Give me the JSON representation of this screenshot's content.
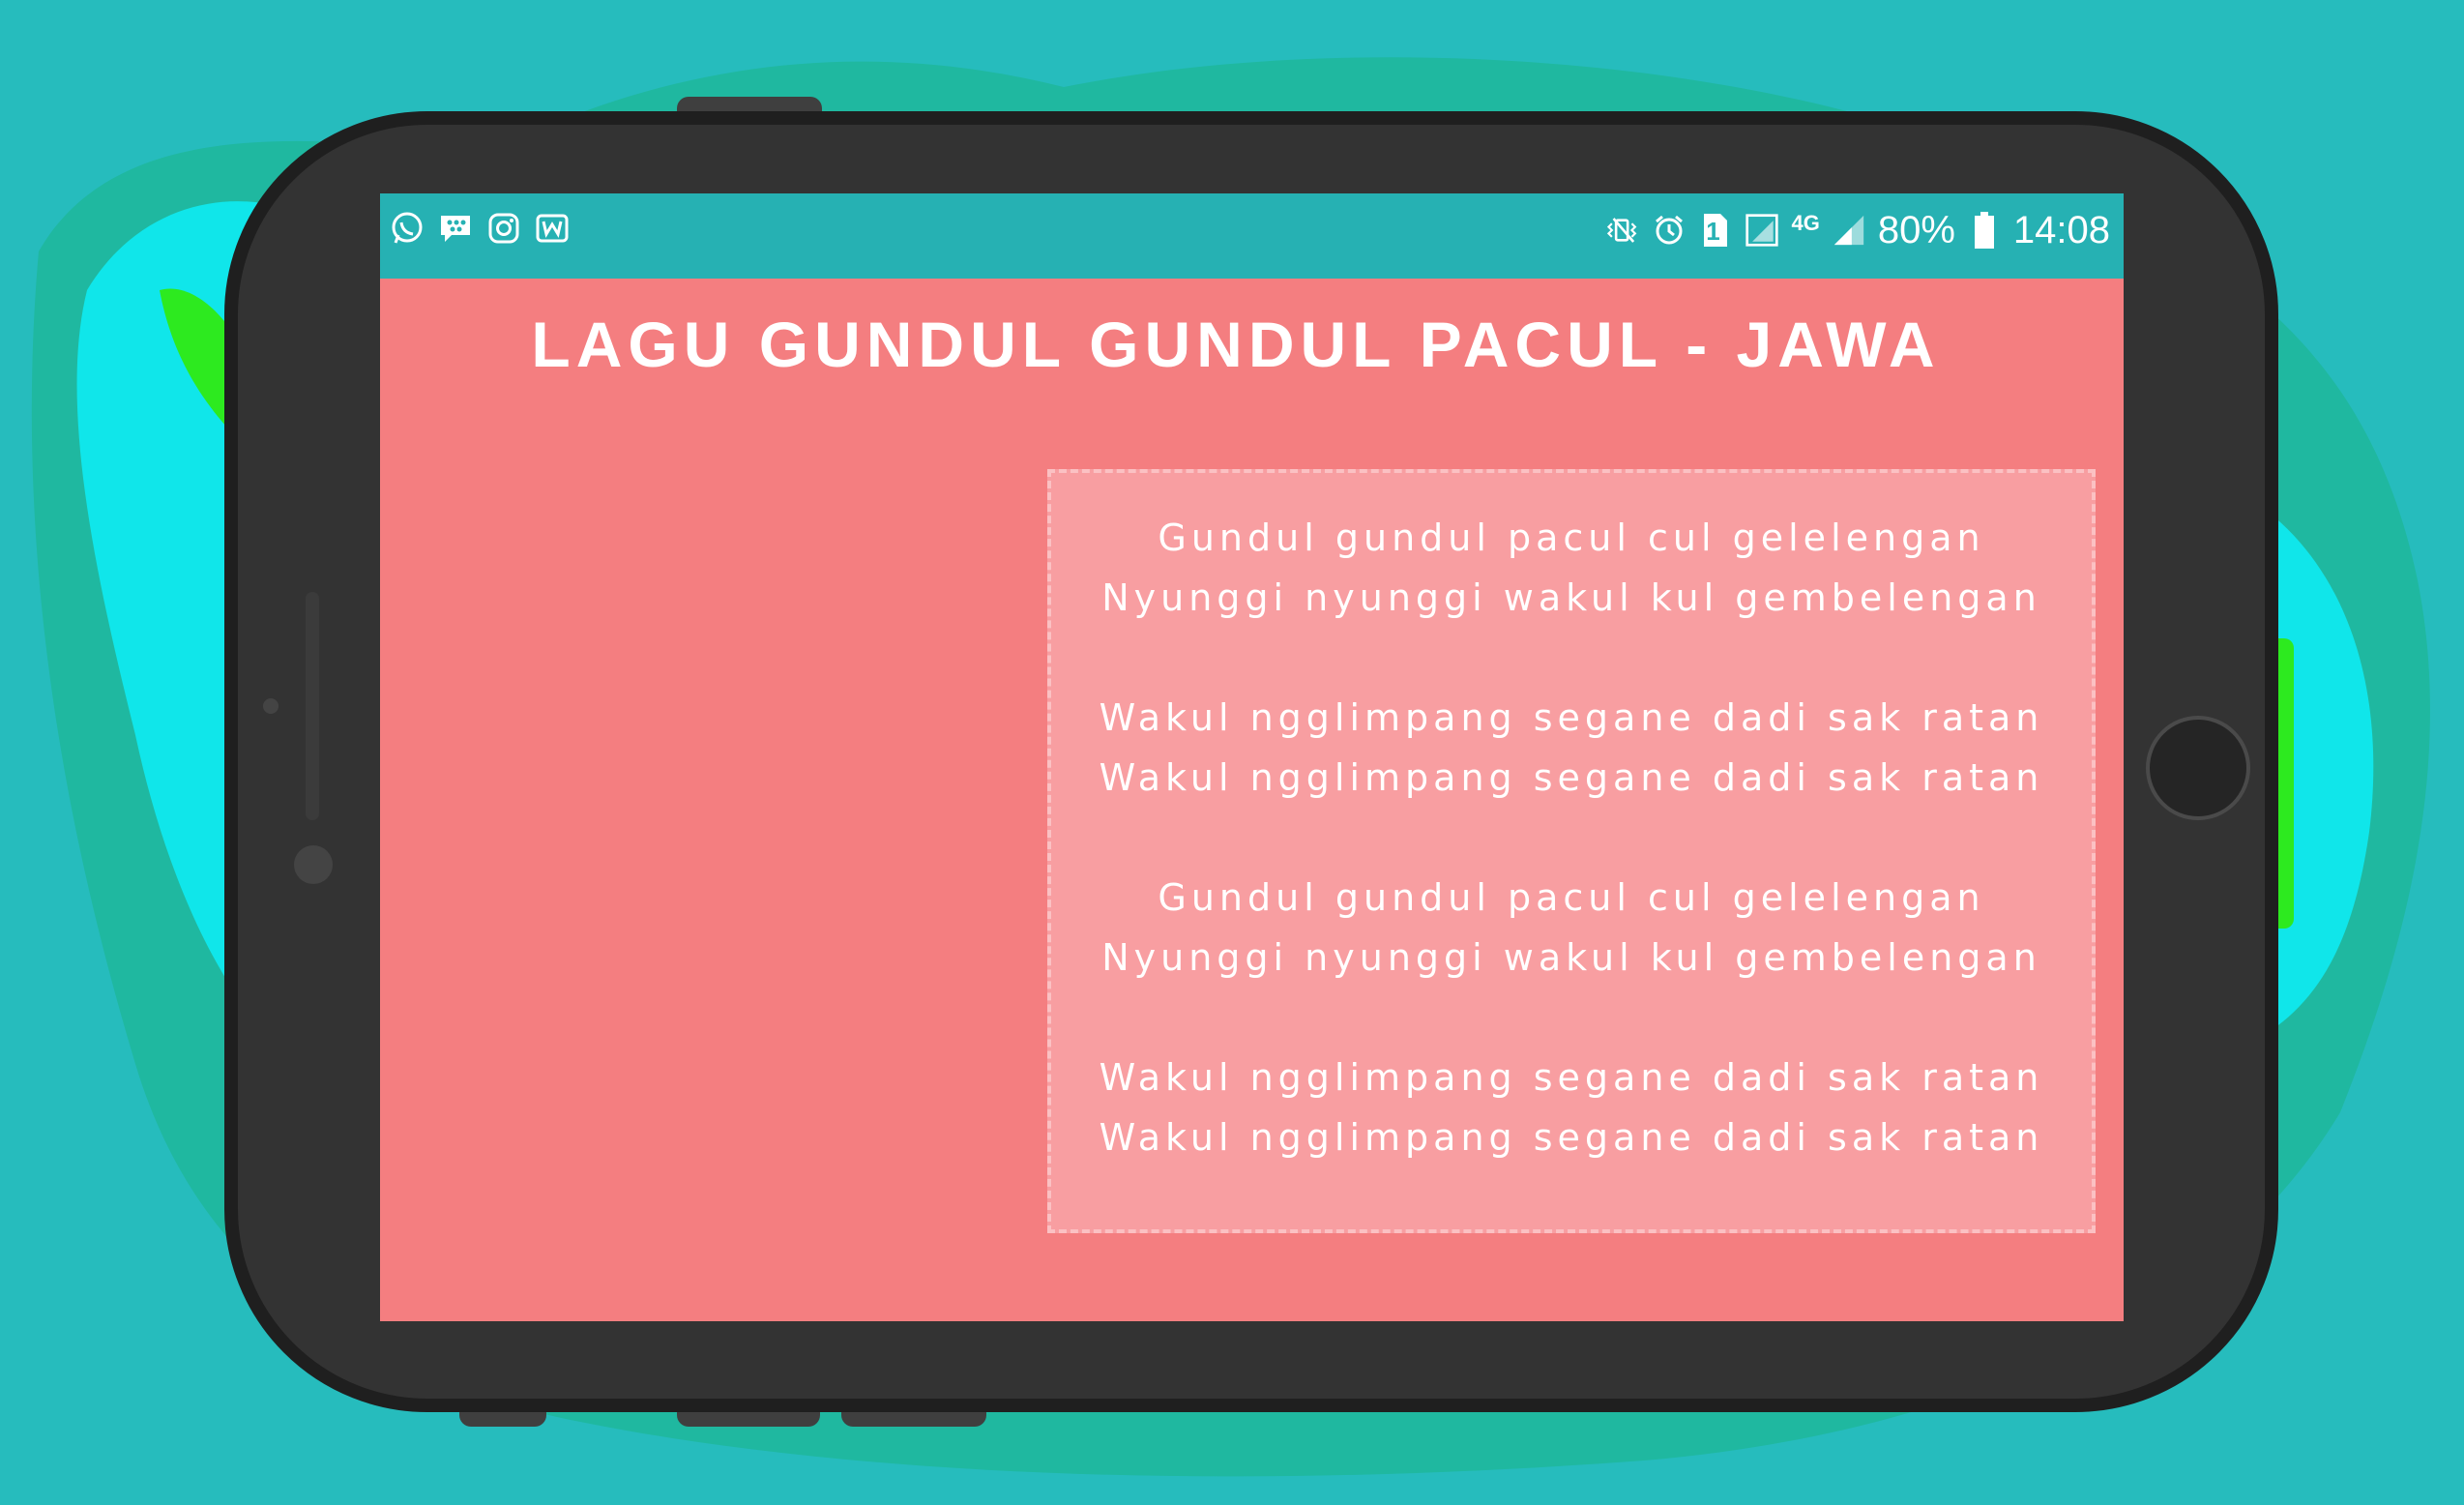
{
  "colors": {
    "background": "#26bcbd",
    "screen": "#f47e80",
    "status_bar": "#26b1b3",
    "lyrics_box": "#f89ea1",
    "phone_body": "#333333",
    "text": "#ffffff"
  },
  "status_bar": {
    "left_icons": [
      "whatsapp-icon",
      "bbm-icon",
      "instagram-icon",
      "wattpad-icon"
    ],
    "right_icons": [
      "vibrate-icon",
      "alarm-icon",
      "sim-icon",
      "signal-icon",
      "network-4g-icon",
      "signal-icon",
      "battery-icon"
    ],
    "network_label": "4G",
    "sim_label": "1",
    "battery": "80%",
    "time": "14:08"
  },
  "page": {
    "title": "LAGU GUNDUL GUNDUL PACUL - JAWA"
  },
  "lyrics": {
    "stanzas": [
      {
        "line1": "Gundul gundul pacul cul gelelengan",
        "line2": "Nyunggi nyunggi wakul kul gembelengan"
      },
      {
        "line1": "Wakul ngglimpang segane dadi sak ratan",
        "line2": "Wakul ngglimpang segane dadi sak ratan"
      },
      {
        "line1": "Gundul gundul pacul cul gelelengan",
        "line2": "Nyunggi nyunggi wakul kul gembelengan"
      },
      {
        "line1": "Wakul ngglimpang segane dadi sak ratan",
        "line2": "Wakul ngglimpang segane dadi sak ratan"
      }
    ]
  }
}
